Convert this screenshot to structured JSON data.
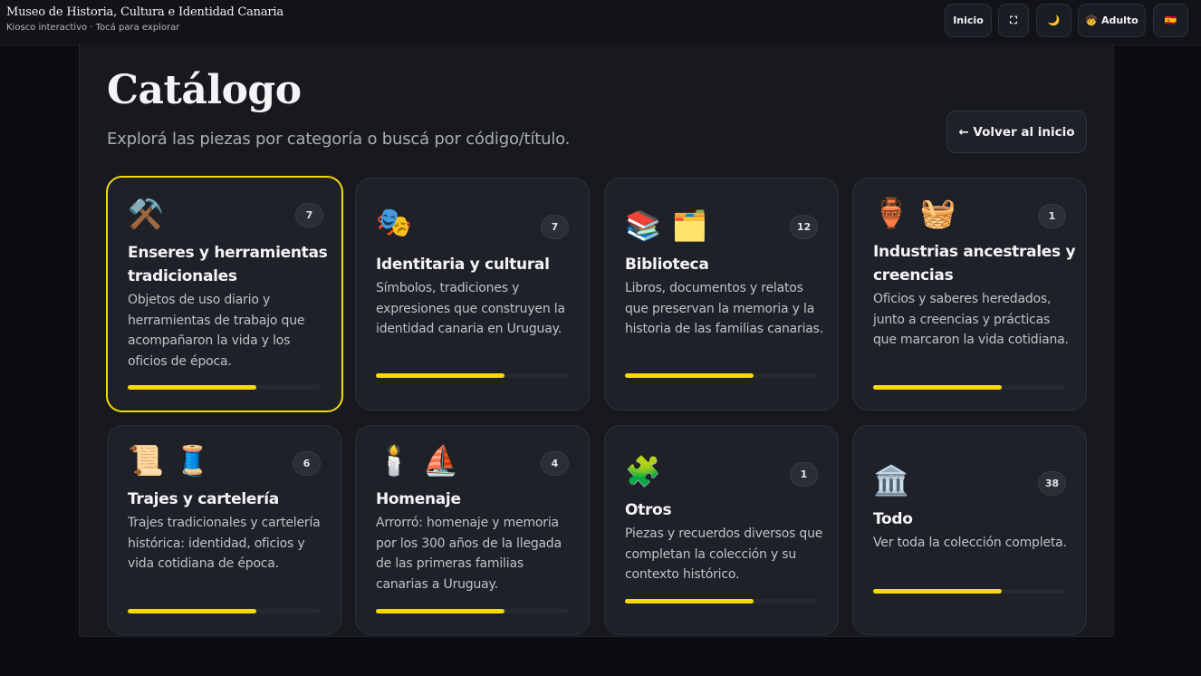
{
  "header": {
    "title": "Museo de Historia, Cultura e Identidad Canaria",
    "subtitle": "Kiosco interactivo · Tocá para explorar",
    "buttons": {
      "home_label": "Inicio",
      "fullscreen_glyph": "⛶",
      "theme_glyph": "🌙",
      "profile_glyph": "🧒",
      "profile_label": "Adulto",
      "language_glyph": "🇪🇸"
    }
  },
  "page": {
    "title": "Catálogo",
    "subtitle": "Explorá las piezas por categoría o buscá por código/título.",
    "back_label": "← Volver al inicio"
  },
  "colors": {
    "accent": "#f5d90a",
    "background": "#0b0d12",
    "panel": "#17191f",
    "card": "#1f2128"
  },
  "categories": [
    {
      "icons": [
        "⚒️"
      ],
      "count": "7",
      "title": "Enseres y herramientas tradicionales",
      "description": "Objetos de uso diario y herramientas de trabajo que acompañaron la vida y los oficios de época.",
      "progress": 0.67,
      "selected": true
    },
    {
      "icons": [
        "🎭"
      ],
      "count": "7",
      "title": "Identitaria y cultural",
      "description": "Símbolos, tradiciones y expresiones que construyen la identidad canaria en Uruguay.",
      "progress": 0.67
    },
    {
      "icons": [
        "📚",
        "🗂️"
      ],
      "count": "12",
      "title": "Biblioteca",
      "description": "Libros, documentos y relatos que preservan la memoria y la historia de las familias canarias.",
      "progress": 0.67
    },
    {
      "icons": [
        "🏺",
        "🧺"
      ],
      "count": "1",
      "title": "Industrias ancestrales y creencias",
      "description": "Oficios y saberes heredados, junto a creencias y prácticas que marcaron la vida cotidiana.",
      "progress": 0.67
    },
    {
      "icons": [
        "📜",
        "🧵"
      ],
      "count": "6",
      "title": "Trajes y cartelería",
      "description": "Trajes tradicionales y cartelería histórica: identidad, oficios y vida cotidiana de época.",
      "progress": 0.67
    },
    {
      "icons": [
        "🕯️",
        "⛵"
      ],
      "count": "4",
      "title": "Homenaje",
      "description": "Arrorró: homenaje y memoria por los 300 años de la llegada de las primeras familias canarias a Uruguay.",
      "progress": 0.67
    },
    {
      "icons": [
        "🧩"
      ],
      "count": "1",
      "title": "Otros",
      "description": "Piezas y recuerdos diversos que completan la colección y su contexto histórico.",
      "progress": 0.67
    },
    {
      "icons": [
        "🏛️"
      ],
      "count": "38",
      "title": "Todo",
      "description": "Ver toda la colección completa.",
      "progress": 0.67
    }
  ]
}
